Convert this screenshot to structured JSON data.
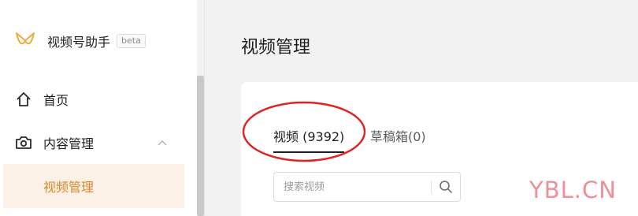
{
  "app": {
    "name": "视频号助手",
    "badge": "beta"
  },
  "sidebar": {
    "items": [
      {
        "label": "首页",
        "icon": "home-icon"
      },
      {
        "label": "内容管理",
        "icon": "camera-icon",
        "expanded": true
      },
      {
        "label": "视频管理",
        "active": true
      }
    ]
  },
  "main": {
    "title": "视频管理",
    "tabs": [
      {
        "label": "视频 (9392)",
        "active": true
      },
      {
        "label": "草稿箱(0)"
      }
    ],
    "search": {
      "placeholder": "搜索视频",
      "value": ""
    }
  },
  "watermark": "YBL.CN",
  "colors": {
    "accent": "#d9882e",
    "active_bg": "#fbf1e6",
    "annotation": "#e02424",
    "watermark": "#ef8f98"
  }
}
